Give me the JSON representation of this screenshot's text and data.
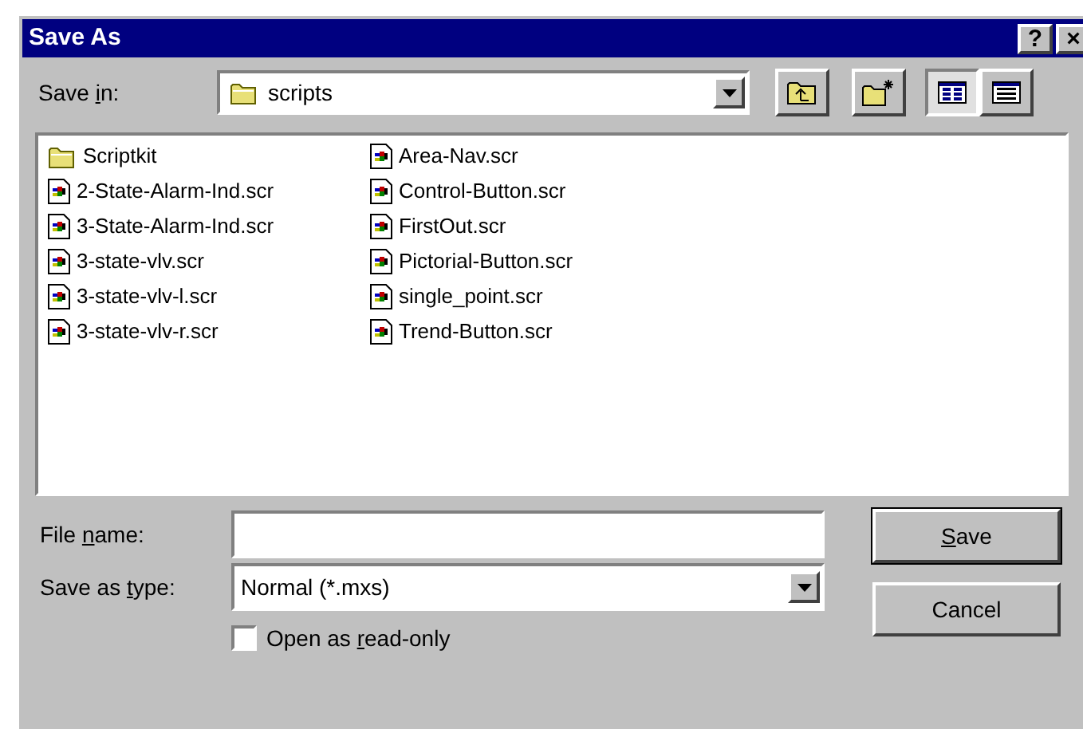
{
  "window": {
    "title": "Save As",
    "title_buttons": [
      "?",
      "×"
    ]
  },
  "save_in": {
    "label": {
      "before": "Save ",
      "key": "i",
      "after": "n:"
    },
    "value": "scripts"
  },
  "toolbar": {
    "views": [
      {
        "kind": "list",
        "selected": true
      },
      {
        "kind": "details",
        "selected": false
      }
    ]
  },
  "files": [
    {
      "name": "Scriptkit",
      "kind": "folder"
    },
    {
      "name": "2-State-Alarm-Ind.scr",
      "kind": "file"
    },
    {
      "name": "3-State-Alarm-Ind.scr",
      "kind": "file"
    },
    {
      "name": "3-state-vlv.scr",
      "kind": "file"
    },
    {
      "name": "3-state-vlv-l.scr",
      "kind": "file"
    },
    {
      "name": "3-state-vlv-r.scr",
      "kind": "file"
    },
    {
      "name": "Area-Nav.scr",
      "kind": "file"
    },
    {
      "name": "Control-Button.scr",
      "kind": "file"
    },
    {
      "name": "FirstOut.scr",
      "kind": "file"
    },
    {
      "name": "Pictorial-Button.scr",
      "kind": "file"
    },
    {
      "name": "single_point.scr",
      "kind": "file"
    },
    {
      "name": "Trend-Button.scr",
      "kind": "file"
    }
  ],
  "file_name": {
    "label": {
      "before": "File ",
      "key": "n",
      "after": "ame:"
    }
  },
  "save_as_type": {
    "label": {
      "before": "Save as ",
      "key": "t",
      "after": "ype:"
    },
    "value": "Normal (*.mxs)"
  },
  "read_only": {
    "label": {
      "before": "Open as ",
      "key": "r",
      "after": "ead-only"
    },
    "checked": false
  },
  "buttons": [
    {
      "label": {
        "key": "S",
        "after": "ave"
      },
      "default": true
    },
    {
      "label": {
        "before": "Cancel"
      },
      "default": false
    }
  ]
}
